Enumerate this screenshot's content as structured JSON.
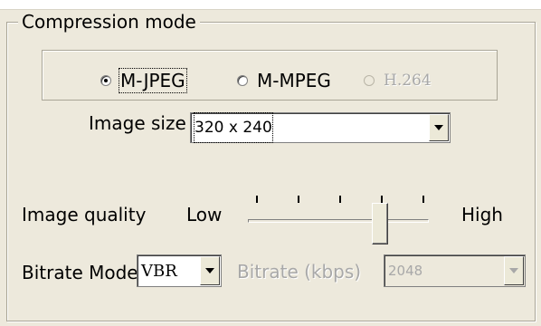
{
  "group": {
    "title": "Compression mode"
  },
  "compression": {
    "options": [
      {
        "label": "M-JPEG",
        "selected": true,
        "enabled": true
      },
      {
        "label": "M-MPEG",
        "selected": false,
        "enabled": true
      },
      {
        "label": "H.264",
        "selected": false,
        "enabled": false
      }
    ]
  },
  "image_size": {
    "label": "Image size",
    "value": "320 x 240"
  },
  "image_quality": {
    "label": "Image quality",
    "low_label": "Low",
    "high_label": "High",
    "level": 0.8,
    "tick_count": 5
  },
  "bitrate_mode": {
    "label": "Bitrate Mode",
    "value": "VBR"
  },
  "bitrate": {
    "label": "Bitrate (kbps)",
    "value": "2048",
    "enabled": false
  }
}
